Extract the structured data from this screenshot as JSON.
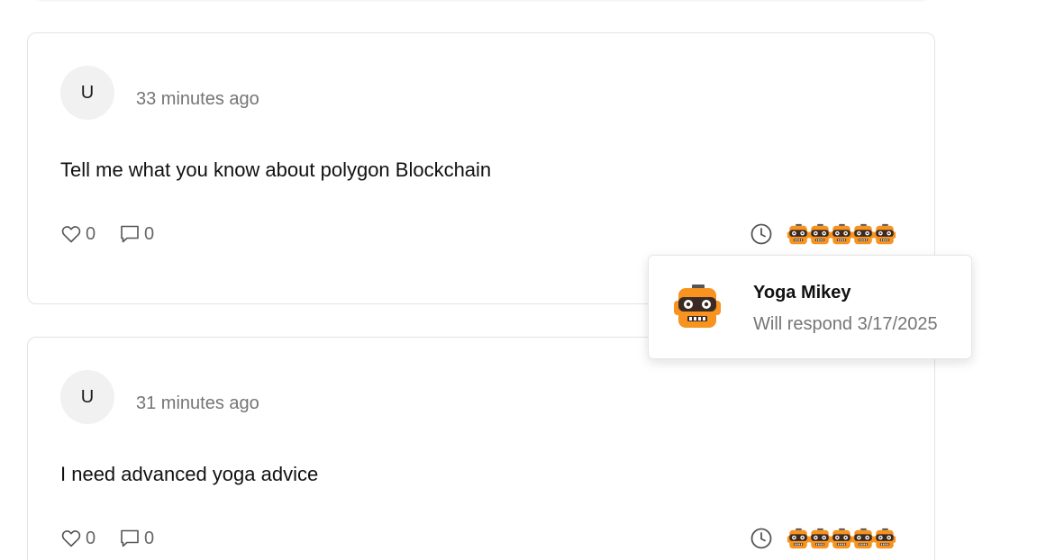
{
  "posts": [
    {
      "avatar_initial": "U",
      "time_ago": "33 minutes ago",
      "text": "Tell me what you know about polygon Blockchain",
      "likes": "0",
      "comments": "0"
    },
    {
      "avatar_initial": "U",
      "time_ago": "31 minutes ago",
      "text": "I need advanced yoga advice",
      "likes": "0",
      "comments": "0"
    }
  ],
  "popover": {
    "name": "Yoga Mikey",
    "status": "Will respond 3/17/2025"
  },
  "colors": {
    "bot_orange": "#f7931e",
    "muted_text": "#757575",
    "border": "#e3e3e3"
  },
  "icons": [
    "heart-icon",
    "comment-icon",
    "clock-icon",
    "bot-avatar-icon"
  ]
}
